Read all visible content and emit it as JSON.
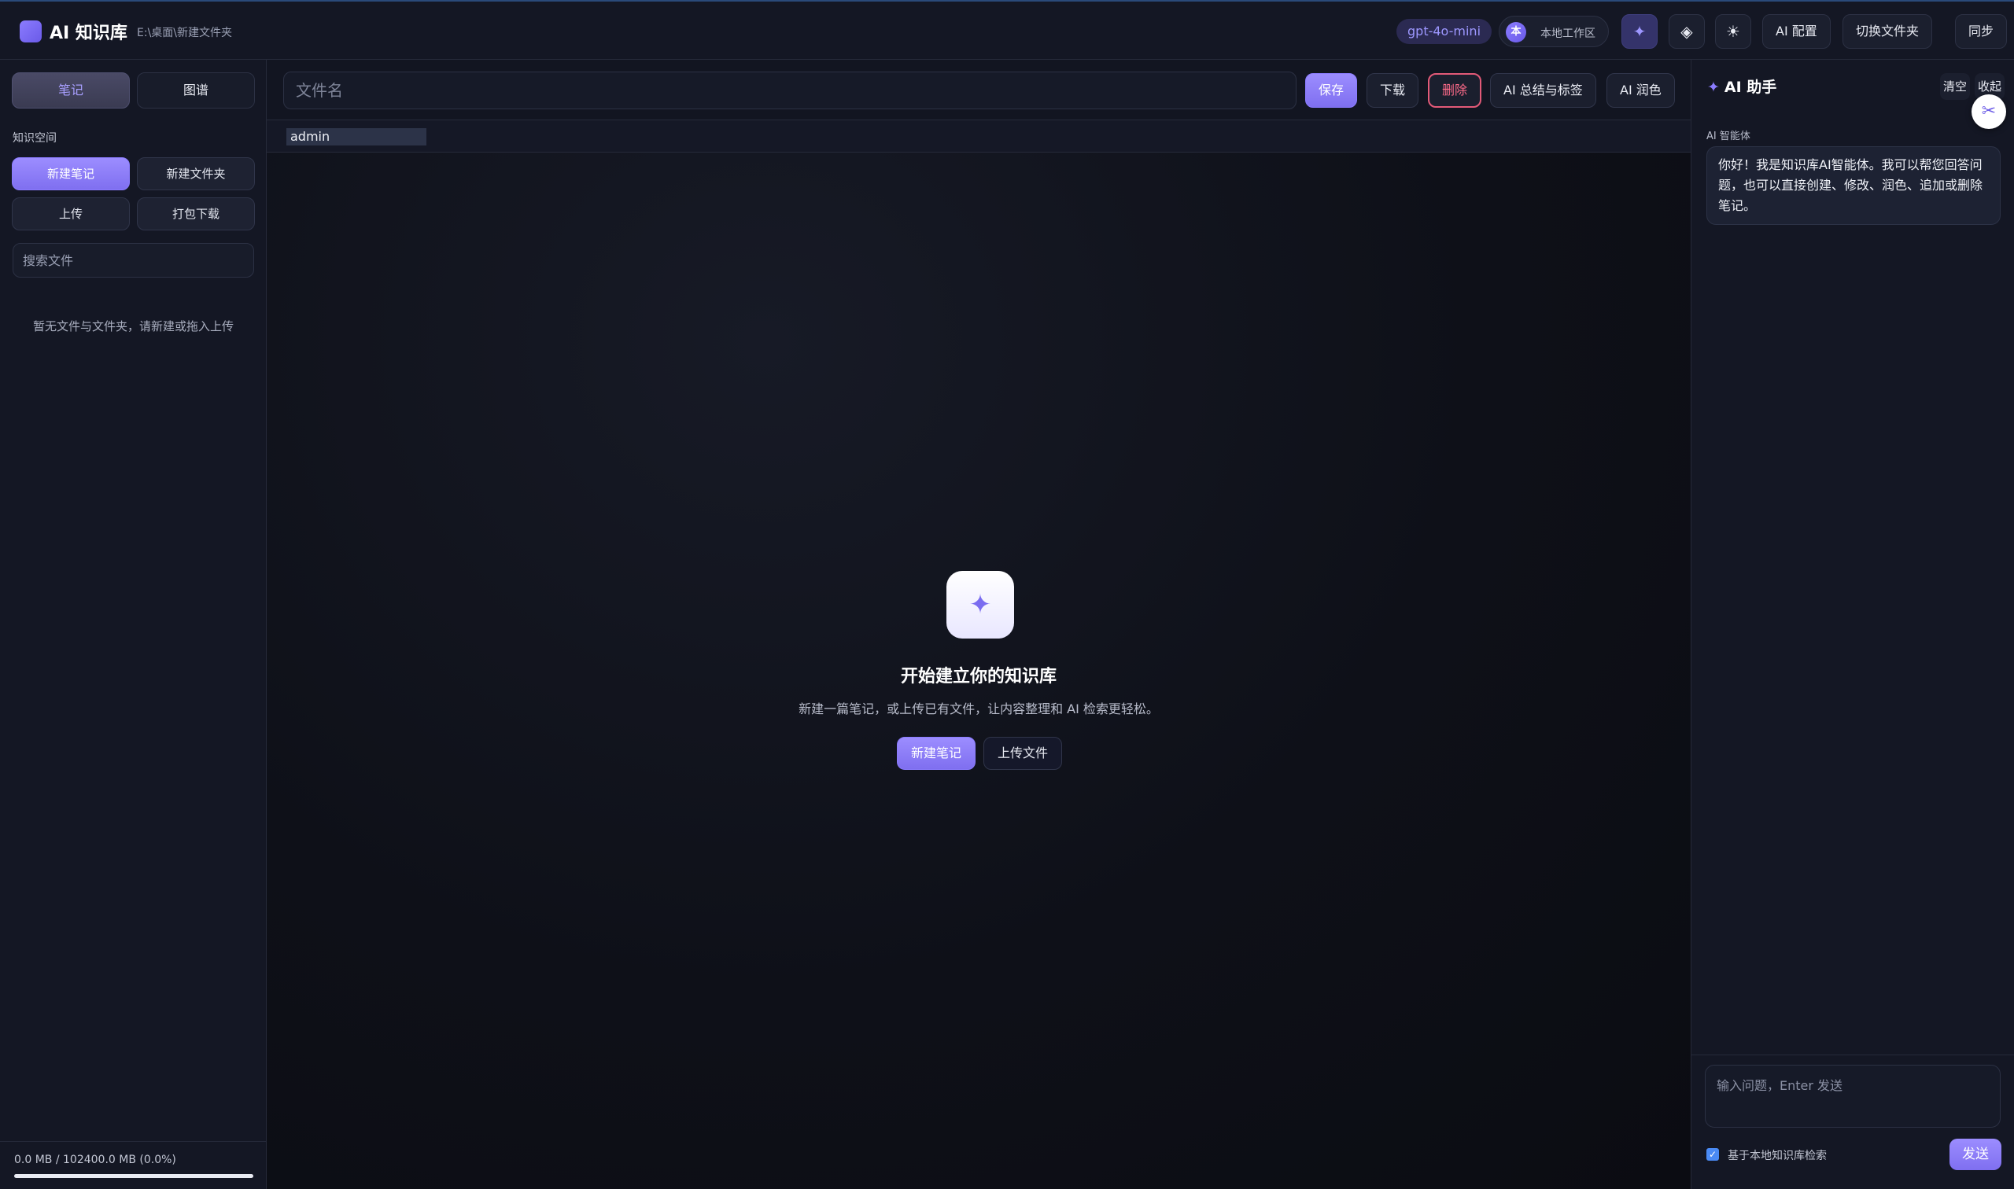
{
  "header": {
    "app_title": "AI 知识库",
    "path": "E:\\桌面\\新建文件夹",
    "model": "gpt-4o-mini",
    "workspace_avatar": "本",
    "workspace_label": "本地工作区",
    "icons": {
      "ai": "✦",
      "diamond": "◈",
      "theme": "☀"
    },
    "ai_config_label": "AI 配置",
    "switch_folder_label": "切换文件夹",
    "sync_label": "同步"
  },
  "sidebar": {
    "tabs": [
      {
        "label": "笔记"
      },
      {
        "label": "图谱"
      }
    ],
    "section_label": "知识空间",
    "buttons": {
      "new_note": "新建笔记",
      "new_folder": "新建文件夹",
      "upload": "上传",
      "pack_download": "打包下载"
    },
    "search_placeholder": "搜索文件",
    "empty_text": "暂无文件与文件夹，请新建或拖入上传",
    "storage_text": "0.0 MB / 102400.0 MB (0.0%)",
    "storage_percent": 0.0
  },
  "editor": {
    "filename_placeholder": "文件名",
    "buttons": {
      "save": "保存",
      "download": "下载",
      "delete": "删除",
      "summarize": "AI 总结与标签",
      "polish": "AI 润色"
    },
    "user": "admin",
    "empty_state": {
      "icon": "✦",
      "title": "开始建立你的知识库",
      "subtitle": "新建一篇笔记，或上传已有文件，让内容整理和 AI 检索更轻松。",
      "new_note": "新建笔记",
      "upload_file": "上传文件"
    }
  },
  "ai_panel": {
    "title_icon": "✦",
    "title": "AI 助手",
    "clear_label": "清空",
    "collapse_label": "收起",
    "float_icon": "✂",
    "agent_label": "AI 智能体",
    "message": "你好！我是知识库AI智能体。我可以帮您回答问题，也可以直接创建、修改、润色、追加或删除笔记。",
    "input_placeholder": "输入问题，Enter 发送",
    "kb_search_label": "基于本地知识库检索",
    "kb_search_checked": true,
    "send_label": "发送"
  },
  "colors": {
    "accent": "#8b7cff",
    "danger": "#ff6b8a",
    "background": "#0d0f17",
    "panel": "#141724"
  }
}
